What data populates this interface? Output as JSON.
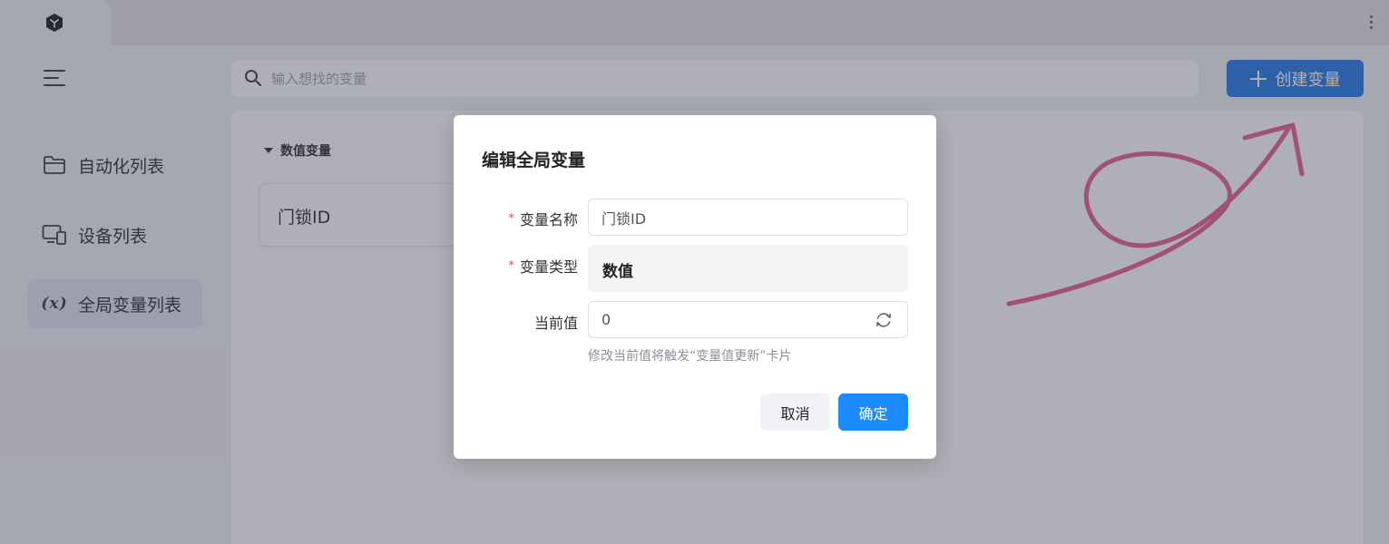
{
  "search": {
    "placeholder": "输入想找的变量"
  },
  "header": {
    "create_label": "创建变量"
  },
  "sidebar": {
    "items": [
      {
        "label": "自动化列表",
        "icon": "folder-icon"
      },
      {
        "label": "设备列表",
        "icon": "devices-icon"
      },
      {
        "label": "全局变量列表",
        "icon": "variable-icon",
        "icon_text": "(x)",
        "active": true
      }
    ]
  },
  "main": {
    "section_title": "数值变量",
    "cards": [
      {
        "name": "门锁ID"
      }
    ]
  },
  "dialog": {
    "title": "编辑全局变量",
    "fields": {
      "name": {
        "label": "变量名称",
        "required_mark": "*",
        "value": "门锁ID"
      },
      "type": {
        "label": "变量类型",
        "required_mark": "*",
        "value": "数值"
      },
      "current": {
        "label": "当前值",
        "value": "0"
      }
    },
    "help": "修改当前值将触发“变量值更新”卡片",
    "cancel_label": "取消",
    "ok_label": "确定"
  },
  "colors": {
    "primary": "#1a73e8",
    "ok_button": "#1a8cff",
    "required": "#e5484d",
    "scribble": "#e7578c"
  }
}
